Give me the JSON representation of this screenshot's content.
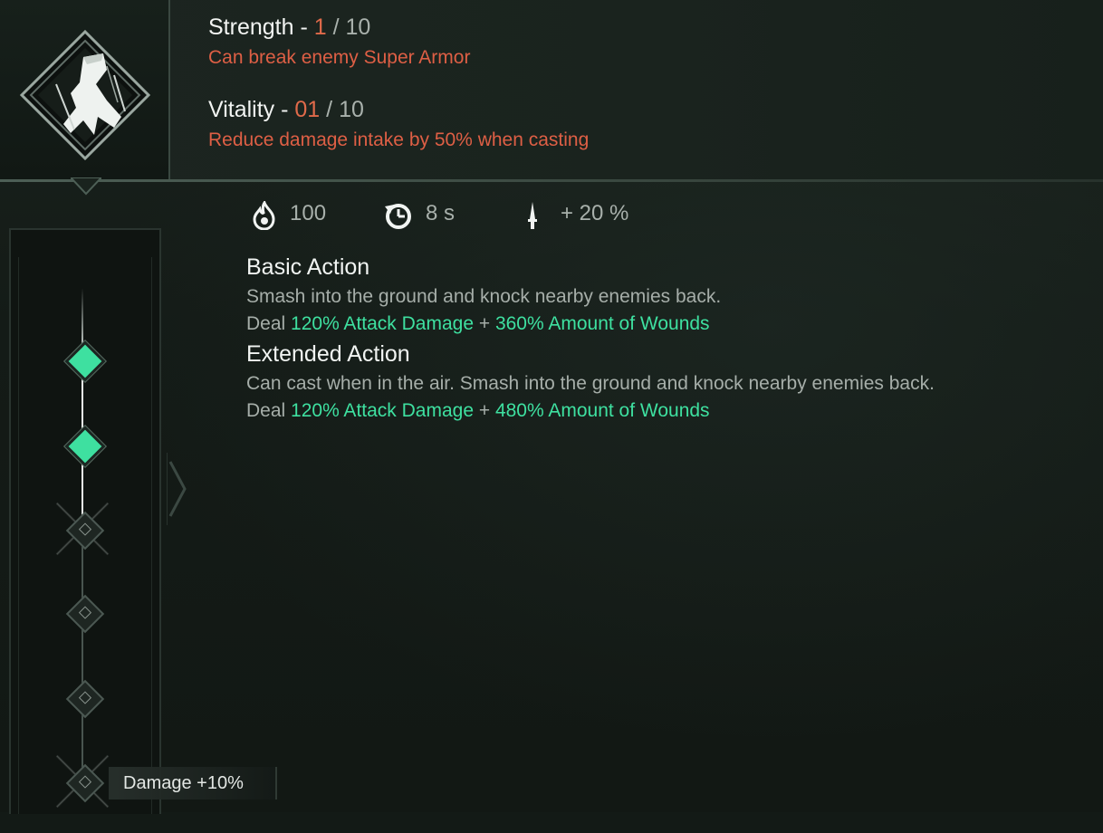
{
  "header": {
    "strength": {
      "label": "Strength -",
      "value": "1",
      "separator": "/",
      "max": "10",
      "desc": "Can break enemy Super Armor"
    },
    "vitality": {
      "label": "Vitality -",
      "value": "01",
      "separator": "/",
      "max": "10",
      "desc": "Reduce damage intake by 50% when casting"
    }
  },
  "stats": {
    "cost": "100",
    "cooldown": "8 s",
    "bonus": "+ 20 %"
  },
  "basic": {
    "title": "Basic Action",
    "desc": "Smash into the ground and knock nearby enemies back.",
    "deal": "Deal",
    "dmg1": "120% Attack Damage",
    "plus": "+",
    "dmg2": "360% Amount of Wounds"
  },
  "extended": {
    "title": "Extended Action",
    "desc": "Can cast when in the air. Smash into the ground and knock nearby enemies back.",
    "deal": "Deal",
    "dmg1": "120% Attack Damage",
    "plus": "+",
    "dmg2": "480% Amount of Wounds"
  },
  "tree": {
    "bottom_tag": "Damage +10%",
    "nodes": [
      "active",
      "active",
      "locked",
      "locked",
      "locked",
      "locked"
    ]
  },
  "colors": {
    "accent_green": "#3ee0a0",
    "accent_red": "#de5f45",
    "text_muted": "#a6aea9"
  },
  "icons": {
    "skill": "claw-smash-icon",
    "cost": "flame-icon",
    "cooldown": "cooldown-clock-icon",
    "bonus": "dagger-icon"
  }
}
